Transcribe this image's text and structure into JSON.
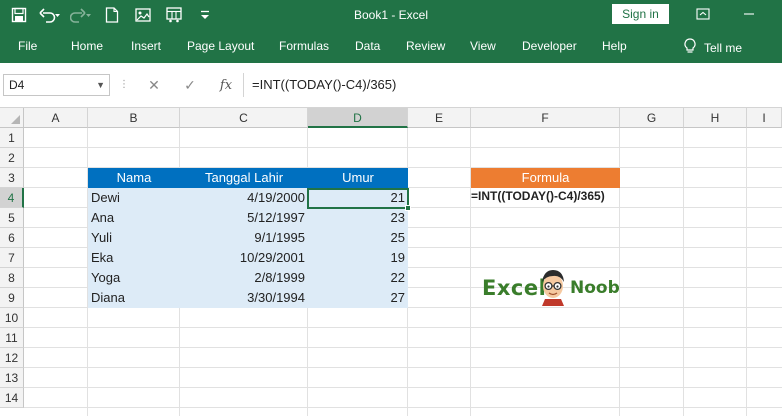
{
  "quick_access": {
    "icons": [
      "save-icon",
      "undo-icon",
      "redo-icon",
      "new-file-icon",
      "image-icon",
      "print-preview-icon",
      "customize-icon"
    ]
  },
  "window": {
    "title": "Book1  -  Excel",
    "signin_label": "Sign in"
  },
  "ribbon": {
    "tabs": [
      "File",
      "Home",
      "Insert",
      "Page Layout",
      "Formulas",
      "Data",
      "Review",
      "View",
      "Developer",
      "Help"
    ],
    "tell_me": "Tell me"
  },
  "formula_bar": {
    "name_box": "D4",
    "fx_label": "fx",
    "formula": "=INT((TODAY()-C4)/365)"
  },
  "grid": {
    "columns": [
      "A",
      "B",
      "C",
      "D",
      "E",
      "F",
      "G",
      "H",
      "I"
    ],
    "rows": [
      "1",
      "2",
      "3",
      "4",
      "5",
      "6",
      "7",
      "8",
      "9",
      "10",
      "11",
      "12",
      "13",
      "14"
    ],
    "selected_column": "D",
    "selected_row": "4"
  },
  "table": {
    "headers": [
      "Nama",
      "Tanggal Lahir",
      "Umur"
    ],
    "rows": [
      [
        "Dewi",
        "4/19/2000",
        "21"
      ],
      [
        "Ana",
        "5/12/1997",
        "23"
      ],
      [
        "Yuli",
        "9/1/1995",
        "25"
      ],
      [
        "Eka",
        "10/29/2001",
        "19"
      ],
      [
        "Yoga",
        "2/8/1999",
        "22"
      ],
      [
        "Diana",
        "3/30/1994",
        "27"
      ]
    ]
  },
  "formula_box": {
    "header": "Formula",
    "text": "=INT((TODAY()-C4)/365)"
  },
  "logo": {
    "word1": "Excel",
    "word2": "Noob"
  },
  "colors": {
    "excel_green": "#217346",
    "table_header_blue": "#0070c0",
    "table_fill": "#ddebf7",
    "formula_header_orange": "#ed7d31",
    "logo_green": "#3a7d2b"
  }
}
